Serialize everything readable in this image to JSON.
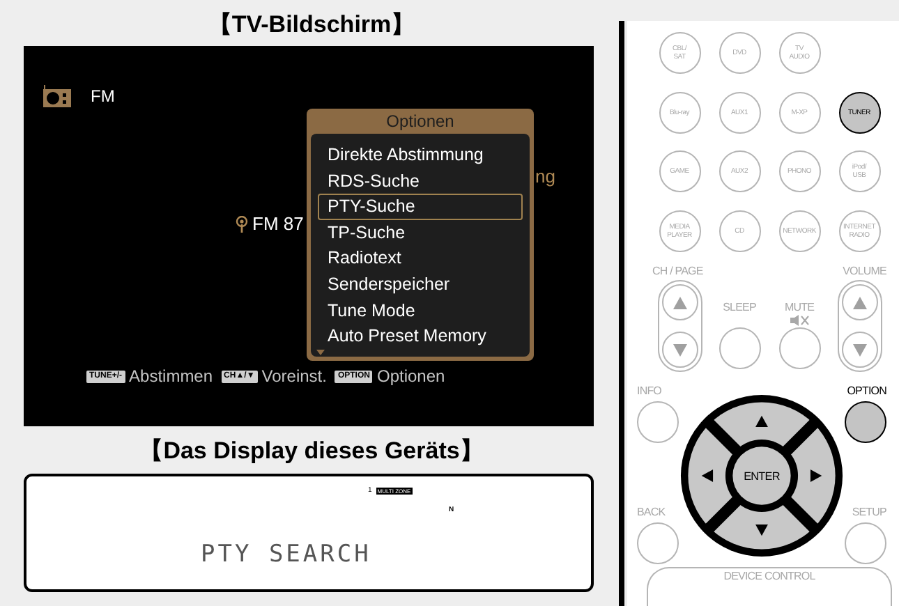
{
  "tv_screen": {
    "heading": "【TV-Bildschirm】",
    "source": "FM",
    "frequency": "FM 87",
    "background_text": "ng",
    "options_menu": {
      "title": "Optionen",
      "items": [
        {
          "label": "Direkte Abstimmung",
          "selected": false
        },
        {
          "label": "RDS-Suche",
          "selected": false
        },
        {
          "label": "PTY-Suche",
          "selected": true
        },
        {
          "label": "TP-Suche",
          "selected": false
        },
        {
          "label": "Radiotext",
          "selected": false
        },
        {
          "label": "Senderspeicher",
          "selected": false
        },
        {
          "label": "Tune Mode",
          "selected": false
        },
        {
          "label": "Auto Preset Memory",
          "selected": false
        }
      ]
    },
    "hints": [
      {
        "key": "TUNE+/-",
        "label": "Abstimmen"
      },
      {
        "key": "CH▲/▼",
        "label": "Voreinst."
      },
      {
        "key": "OPTION",
        "label": "Optionen"
      }
    ]
  },
  "device_display": {
    "heading": "【Das Display dieses Geräts】",
    "indicators": [
      "1",
      "MULTI ZONE",
      "N"
    ],
    "text": "PTY SEARCH"
  },
  "remote": {
    "source_rows": [
      [
        {
          "label": "CBL/\nSAT",
          "selected": false
        },
        {
          "label": "DVD",
          "selected": false
        },
        {
          "label": "TV\nAUDIO",
          "selected": false
        }
      ],
      [
        {
          "label": "Blu-ray",
          "selected": false
        },
        {
          "label": "AUX1",
          "selected": false
        },
        {
          "label": "M-XP",
          "selected": false
        },
        {
          "label": "TUNER",
          "selected": true
        }
      ],
      [
        {
          "label": "GAME",
          "selected": false
        },
        {
          "label": "AUX2",
          "selected": false
        },
        {
          "label": "PHONO",
          "selected": false
        },
        {
          "label": "iPod/\nUSB",
          "selected": false
        }
      ],
      [
        {
          "label": "MEDIA\nPLAYER",
          "selected": false
        },
        {
          "label": "CD",
          "selected": false
        },
        {
          "label": "NETWORK",
          "selected": false
        },
        {
          "label": "INTERNET\nRADIO",
          "selected": false
        }
      ]
    ],
    "ch_page_label": "CH / PAGE",
    "volume_label": "VOLUME",
    "sleep_label": "SLEEP",
    "mute_label": "MUTE",
    "info_label": "INFO",
    "option": {
      "label": "OPTION",
      "selected": true
    },
    "enter": "ENTER",
    "back_label": "BACK",
    "setup_label": "SETUP",
    "device_control_label": "DEVICE CONTROL"
  }
}
